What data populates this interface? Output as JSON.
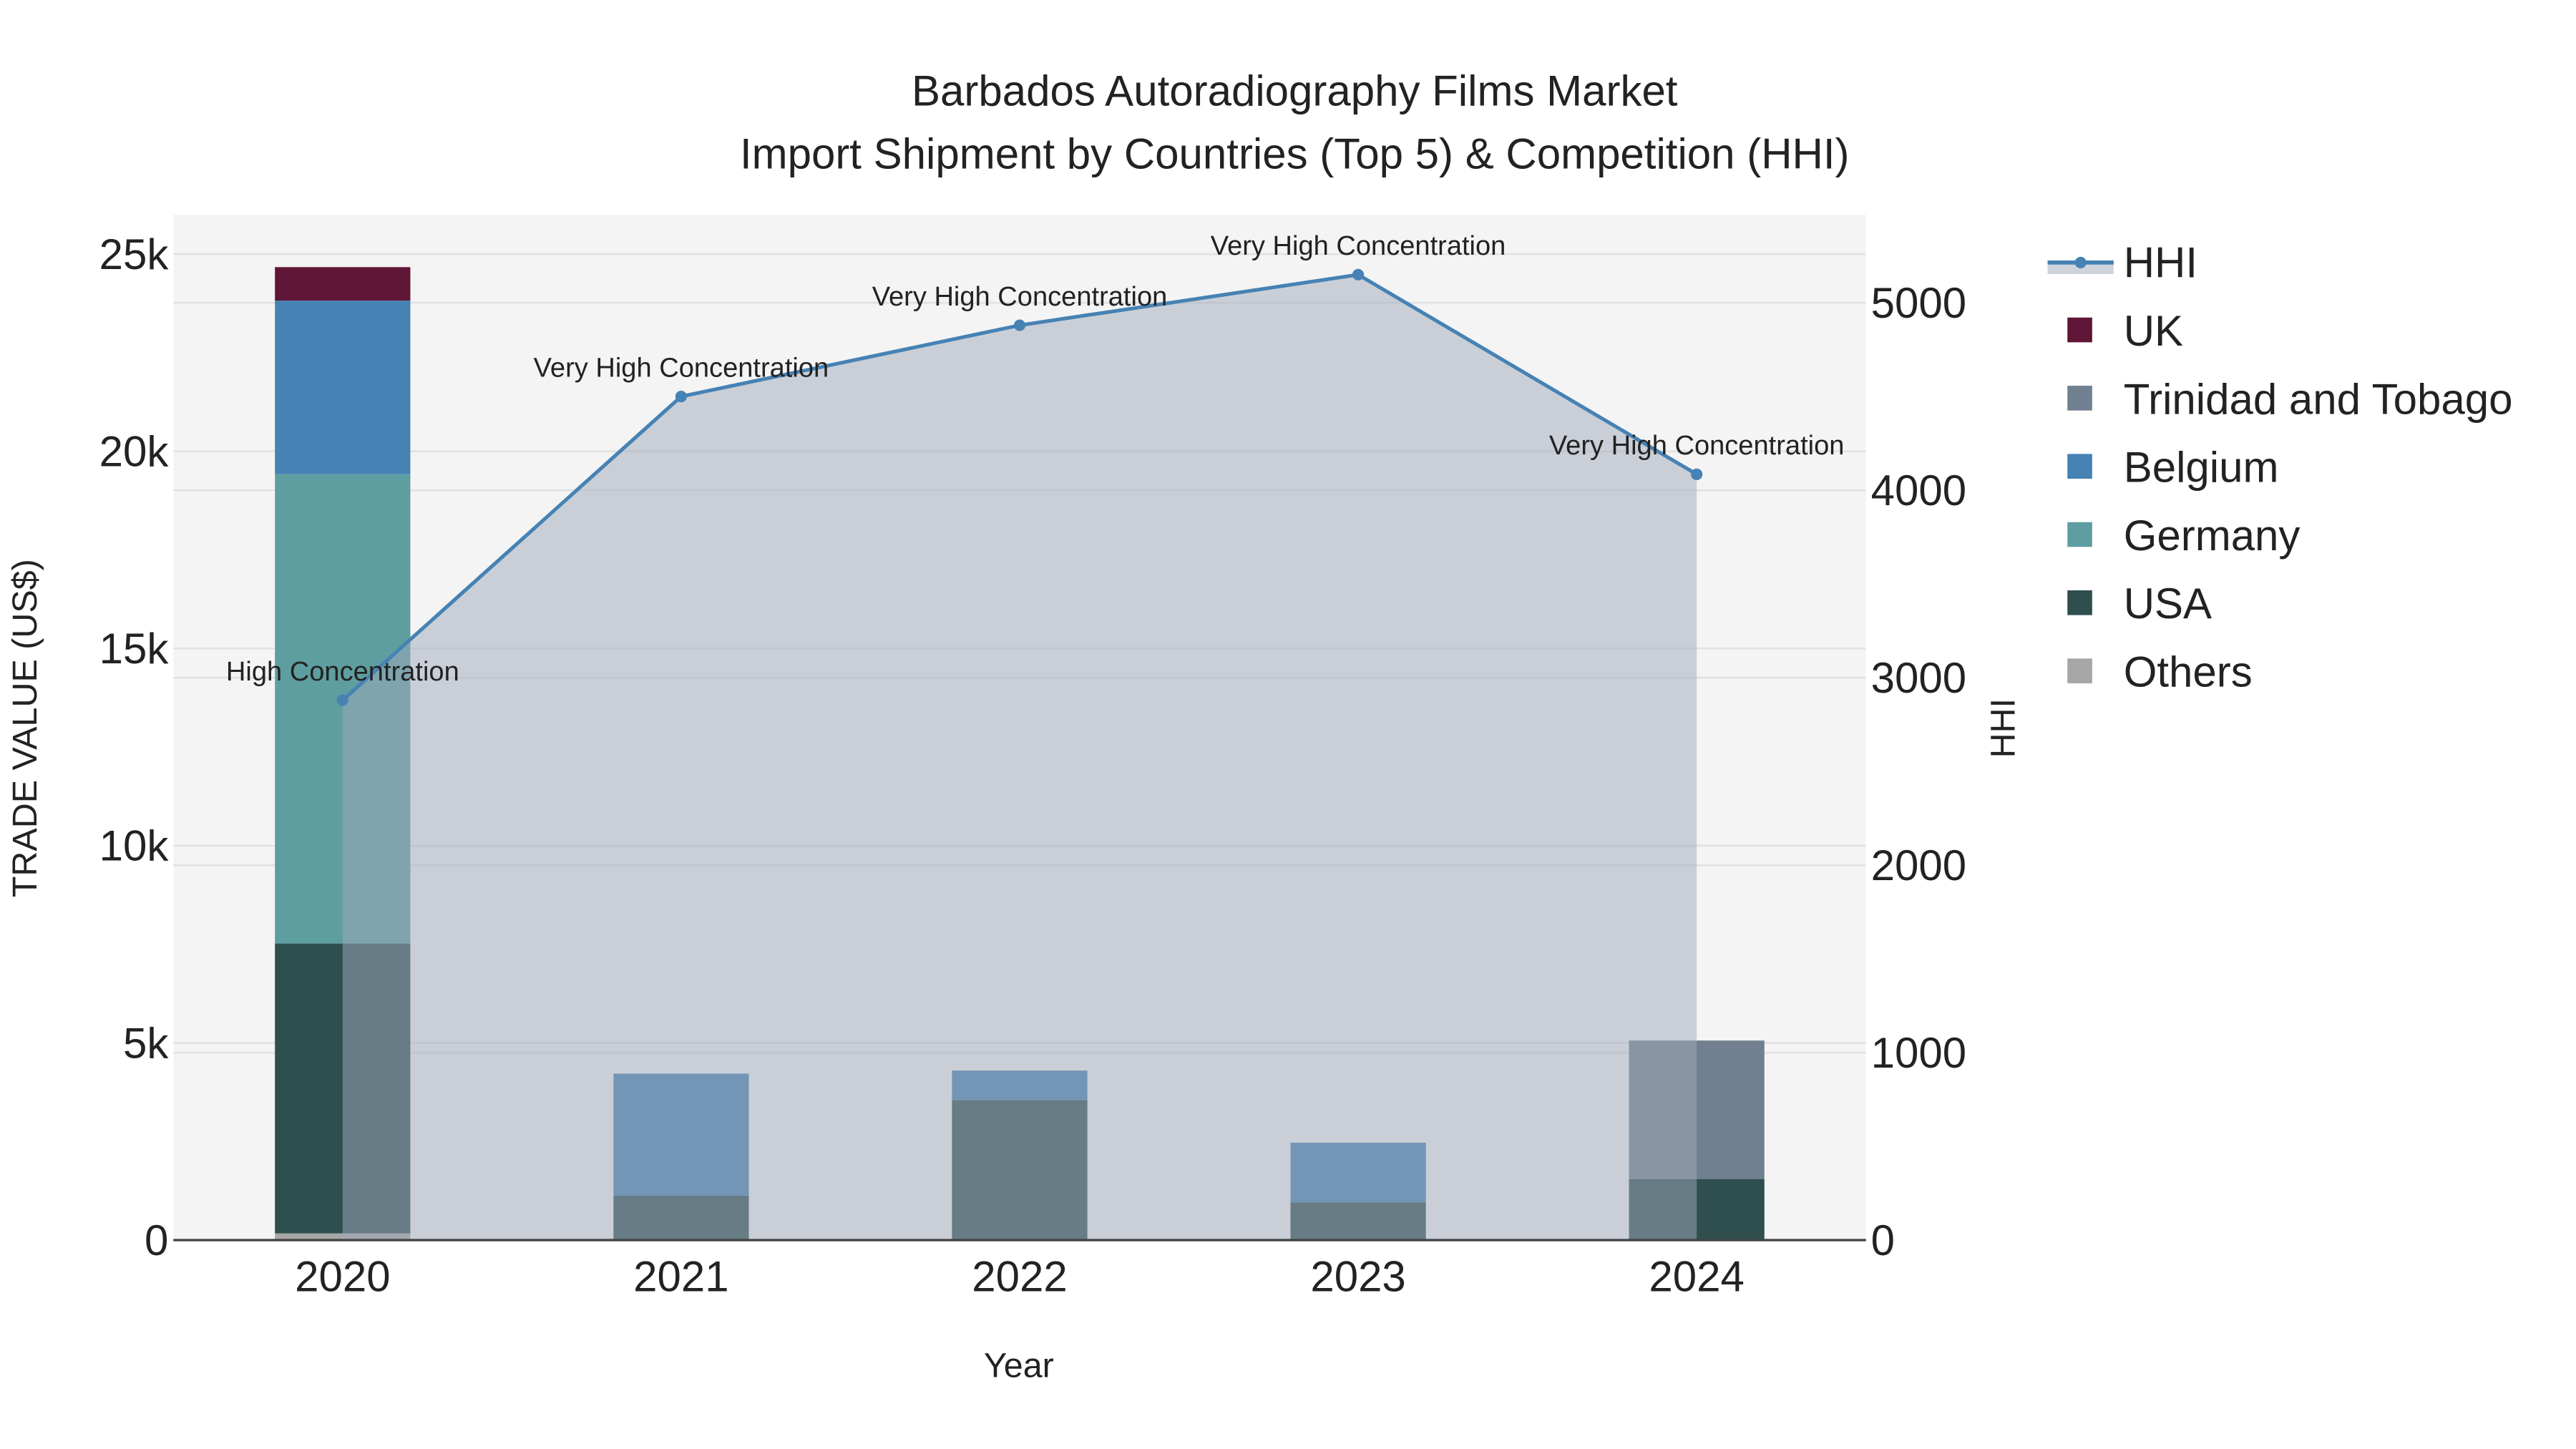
{
  "chart_data": {
    "type": "bar",
    "title": "Barbados Autoradiography Films Market",
    "subtitle": "Import Shipment by Countries (Top 5) & Competition (HHI)",
    "xlabel": "Year",
    "ylabel": "TRADE VALUE (US$)",
    "y2label": "HHI",
    "categories": [
      "2020",
      "2021",
      "2022",
      "2023",
      "2024"
    ],
    "ylim": [
      0,
      26000
    ],
    "yticks": [
      0,
      5000,
      10000,
      15000,
      20000,
      25000
    ],
    "ytick_labels": [
      "0",
      "5k",
      "10k",
      "15k",
      "20k",
      "25k"
    ],
    "y2lim": [
      0,
      5470
    ],
    "y2ticks": [
      0,
      1000,
      2000,
      3000,
      4000,
      5000
    ],
    "y2tick_labels": [
      "0",
      "1000",
      "2000",
      "3000",
      "4000",
      "5000"
    ],
    "grid": true,
    "legend_placement": "right",
    "series": [
      {
        "name": "Others",
        "color": "#a6a6a6",
        "values": [
          170,
          0,
          0,
          0,
          0
        ]
      },
      {
        "name": "USA",
        "color": "#2f4f4f",
        "values": [
          7350,
          1130,
          3550,
          960,
          1550
        ]
      },
      {
        "name": "Germany",
        "color": "#5f9ea0",
        "values": [
          11900,
          0,
          0,
          0,
          0
        ]
      },
      {
        "name": "Belgium",
        "color": "#4682b4",
        "values": [
          4400,
          3090,
          750,
          1510,
          0
        ]
      },
      {
        "name": "Trinidad and Tobago",
        "color": "#708090",
        "values": [
          0,
          0,
          0,
          0,
          3510
        ]
      },
      {
        "name": "UK",
        "color": "#601636",
        "values": [
          850,
          0,
          0,
          0,
          0
        ]
      }
    ],
    "hhi": {
      "name": "HHI",
      "color": "#4682b4",
      "values": [
        2880,
        4500,
        4880,
        5150,
        4085
      ],
      "annotations": [
        "High Concentration",
        "Very High Concentration",
        "Very High Concentration",
        "Very High Concentration",
        "Very High Concentration"
      ]
    },
    "legend_order": [
      "HHI",
      "UK",
      "Trinidad and Tobago",
      "Belgium",
      "Germany",
      "USA",
      "Others"
    ]
  }
}
